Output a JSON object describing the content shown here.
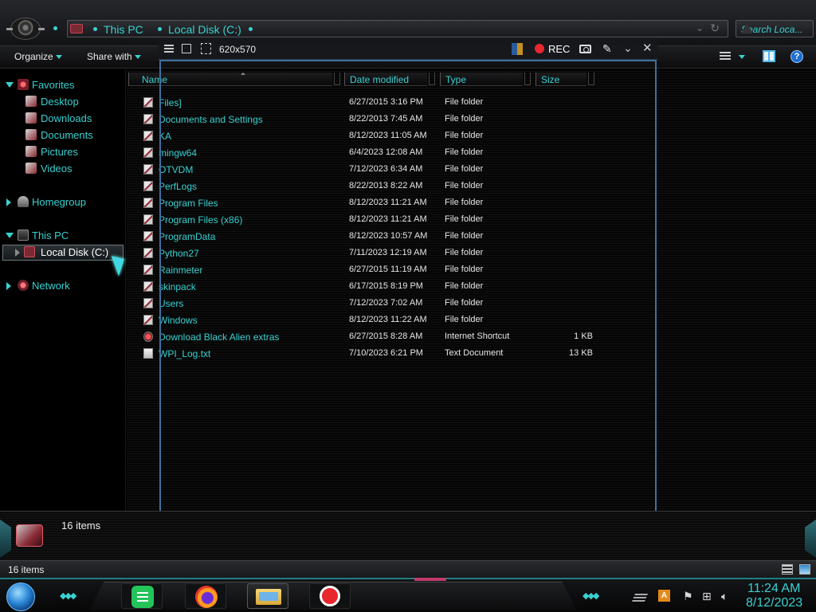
{
  "address": {
    "crumbs": [
      "This PC",
      "Local Disk (C:)"
    ],
    "search_placeholder": "Search Loca..."
  },
  "toolbar": {
    "organize_label": "Organize",
    "share_label": "Share with"
  },
  "nav": {
    "favorites": "Favorites",
    "fav_items": [
      "Desktop",
      "Downloads",
      "Documents",
      "Pictures",
      "Videos"
    ],
    "homegroup": "Homegroup",
    "this_pc": "This PC",
    "local_disk": "Local Disk (C:)",
    "network": "Network"
  },
  "columns": {
    "name": "Name",
    "date": "Date modified",
    "type": "Type",
    "size": "Size"
  },
  "files": [
    {
      "name": "Files]",
      "date": "6/27/2015 3:16 PM",
      "type": "File folder",
      "size": ""
    },
    {
      "name": "Documents and Settings",
      "date": "8/22/2013 7:45 AM",
      "type": "File folder",
      "size": ""
    },
    {
      "name": "KA",
      "date": "8/12/2023 11:05 AM",
      "type": "File folder",
      "size": ""
    },
    {
      "name": "mingw64",
      "date": "6/4/2023 12:08 AM",
      "type": "File folder",
      "size": ""
    },
    {
      "name": "OTVDM",
      "date": "7/12/2023 6:34 AM",
      "type": "File folder",
      "size": ""
    },
    {
      "name": "PerfLogs",
      "date": "8/22/2013 8:22 AM",
      "type": "File folder",
      "size": ""
    },
    {
      "name": "Program Files",
      "date": "8/12/2023 11:21 AM",
      "type": "File folder",
      "size": ""
    },
    {
      "name": "Program Files (x86)",
      "date": "8/12/2023 11:21 AM",
      "type": "File folder",
      "size": ""
    },
    {
      "name": "ProgramData",
      "date": "8/12/2023 10:57 AM",
      "type": "File folder",
      "size": ""
    },
    {
      "name": "Python27",
      "date": "7/11/2023 12:19 AM",
      "type": "File folder",
      "size": ""
    },
    {
      "name": "Rainmeter",
      "date": "6/27/2015 11:19 AM",
      "type": "File folder",
      "size": ""
    },
    {
      "name": "skinpack",
      "date": "6/17/2015 8:19 PM",
      "type": "File folder",
      "size": ""
    },
    {
      "name": "Users",
      "date": "7/12/2023 7:02 AM",
      "type": "File folder",
      "size": ""
    },
    {
      "name": "Windows",
      "date": "8/12/2023 11:22 AM",
      "type": "File folder",
      "size": ""
    },
    {
      "name": "Download Black Alien extras",
      "date": "6/27/2015 8:28 AM",
      "type": "Internet Shortcut",
      "size": "1 KB"
    },
    {
      "name": "WPI_Log.txt",
      "date": "7/10/2023 6:21 PM",
      "type": "Text Document",
      "size": "13 KB"
    }
  ],
  "recorder": {
    "size_readout": "620x570",
    "rec_label": "REC"
  },
  "details": {
    "count": "16 items"
  },
  "status": {
    "count": "16 items"
  },
  "clock": {
    "time": "11:24 AM",
    "date": "8/12/2023"
  },
  "tray": {
    "ime": "A"
  },
  "colors": {
    "accent": "#39d0d0",
    "record": "#e8262e",
    "frame": "#3f6f9e"
  },
  "icons": {
    "back": "back-orb-icon",
    "folder": "folder-icon",
    "shortcut": "internet-shortcut-icon",
    "text": "text-document-icon",
    "record": "record-icon",
    "camera": "camera-icon",
    "pen": "pen-icon"
  }
}
